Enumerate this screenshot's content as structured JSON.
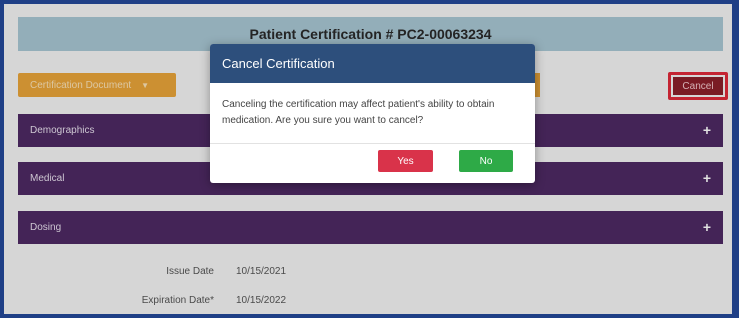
{
  "header": {
    "title": "Patient Certification # PC2-00063234"
  },
  "toolbar": {
    "certification_document_label": "Certification Document",
    "cancel_label": "Cancel"
  },
  "sections": [
    {
      "label": "Demographics",
      "icon": "plus-icon"
    },
    {
      "label": "Medical",
      "icon": "plus-icon"
    },
    {
      "label": "Dosing",
      "icon": "plus-icon"
    }
  ],
  "fields": {
    "issue_date": {
      "label": "Issue Date",
      "value": "10/15/2021"
    },
    "expiration_date": {
      "label": "Expiration Date*",
      "value": "10/15/2022"
    }
  },
  "modal": {
    "title": "Cancel Certification",
    "message": "Canceling the certification may affect patient's ability to obtain medication. Are you sure you want to cancel?",
    "yes_label": "Yes",
    "no_label": "No"
  },
  "colors": {
    "frame_border": "#1f3f86",
    "header_bar": "#a8c6d3",
    "section_bar": "#4e2a63",
    "modal_header": "#2d4f7c",
    "yes_button": "#d9334a",
    "no_button": "#2eaa47",
    "cancel_highlight": "#e0293a",
    "cert_doc_button": "#e9a43a"
  }
}
